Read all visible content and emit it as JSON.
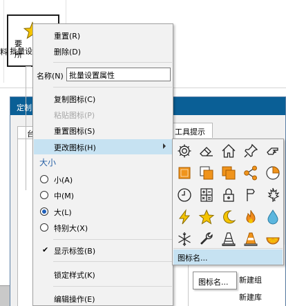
{
  "ribbon": {
    "partial_label": "料",
    "batch_button_label": "批量设置"
  },
  "dialog": {
    "title": "定制",
    "tab_partial": "台",
    "text1": "要",
    "text2": "所",
    "tool_tab": "工具提示",
    "tree_items": [
      "新建组",
      "新建库"
    ]
  },
  "context_menu": {
    "reset": "重置(R)",
    "delete": "删除(D)",
    "name_label": "名称(N)",
    "name_value": "批量设置属性",
    "copy_icon": "复制图标(C)",
    "paste_icon": "粘贴图标(P)",
    "reset_icon": "重置图标(S)",
    "change_icon": "更改图标(H)",
    "size_heading": "大小",
    "sizes": [
      {
        "label": "小(A)",
        "selected": false
      },
      {
        "label": "中(M)",
        "selected": false
      },
      {
        "label": "大(L)",
        "selected": true
      },
      {
        "label": "特别大(X)",
        "selected": false
      }
    ],
    "show_label": "显示标签(B)",
    "show_label_checked": true,
    "lock_style": "锁定样式(K)",
    "edit_action": "编辑操作(E)"
  },
  "icon_submenu": {
    "icons": [
      "gear-icon",
      "eraser-icon",
      "house-icon",
      "pushpin-icon",
      "hand-pointer-icon",
      "square-orange-icon",
      "square-half-icon",
      "squares-overlap-icon",
      "network-icon",
      "pie-quarter-icon",
      "clock-icon",
      "calculator-icon",
      "padlock-icon",
      "flag-icon",
      "maple-leaf-icon",
      "lightning-icon",
      "star-icon",
      "crescent-moon-icon",
      "flame-icon",
      "water-drop-icon",
      "snowflake-icon",
      "wrench-icon",
      "traffic-cone-icon",
      "traffic-cone-orange-icon",
      "orange-slice-icon"
    ],
    "icon_name_item": "图标名..."
  },
  "tooltip": {
    "text": "图标名..."
  },
  "colors": {
    "accent_orange": "#f0941c",
    "star_yellow": "#f5c400",
    "highlight": "#c6e2f2",
    "title_blue": "#0a5f96"
  }
}
